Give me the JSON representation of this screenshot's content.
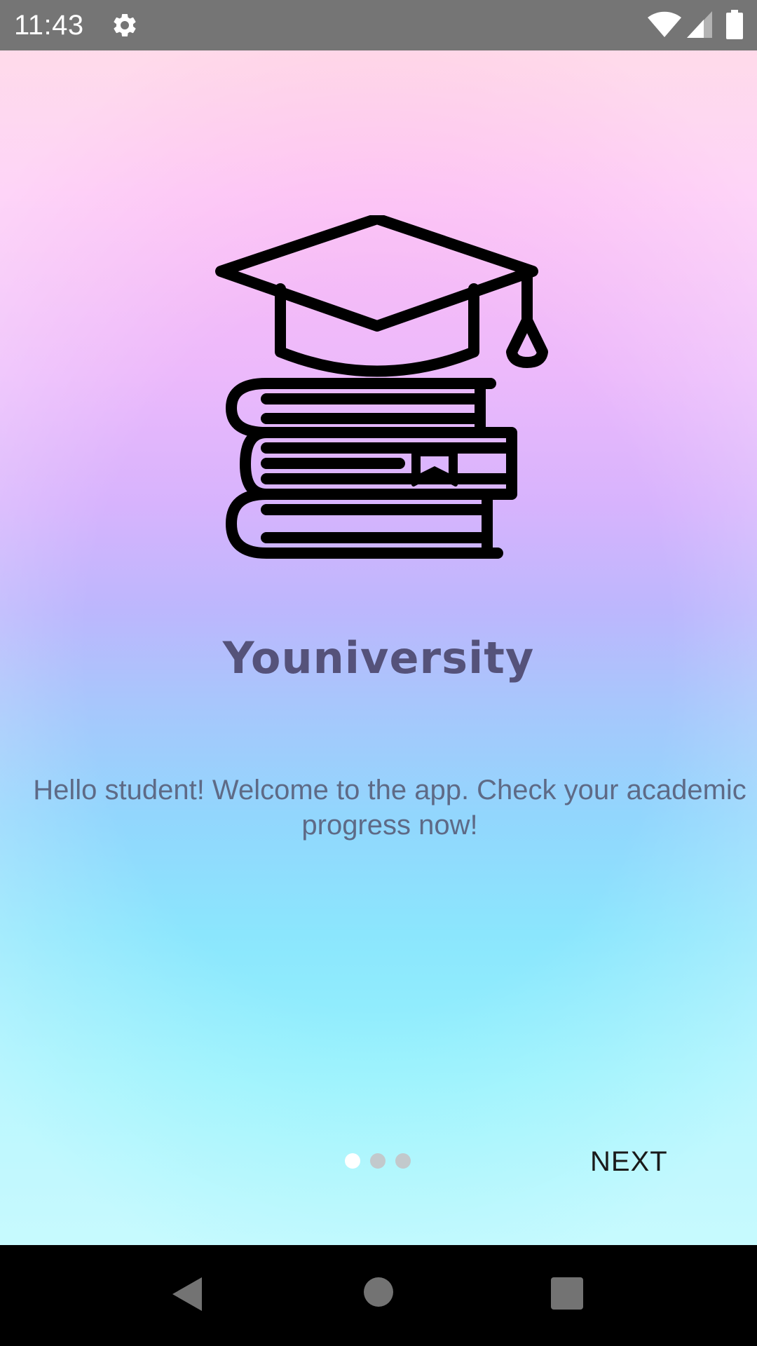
{
  "status_bar": {
    "time": "11:43",
    "icons": [
      "gear-icon",
      "wifi-icon",
      "signal-icon",
      "battery-icon"
    ]
  },
  "onboarding": {
    "illustration": "graduation-cap-on-books-icon",
    "title": "Youniversity",
    "description_line1": "Hello student! Welcome to the app. Check your academic",
    "description_line2": "progress now!",
    "page_indicator": {
      "total": 3,
      "current": 1
    },
    "next_label": "NEXT"
  },
  "navigation_bar": {
    "icons": [
      "back-icon",
      "home-icon",
      "recents-icon"
    ]
  },
  "colors": {
    "status_bar": "#757575",
    "gradient_top": "#ffc7df",
    "gradient_middle": "#bcb7fd",
    "gradient_bottom": "#a9f7fd",
    "title_text": "#55527a",
    "body_text": "#5e6a86",
    "dot_active": "#ffffff",
    "dot_inactive": "#c2c9cc",
    "nav_bar": "#000000"
  }
}
